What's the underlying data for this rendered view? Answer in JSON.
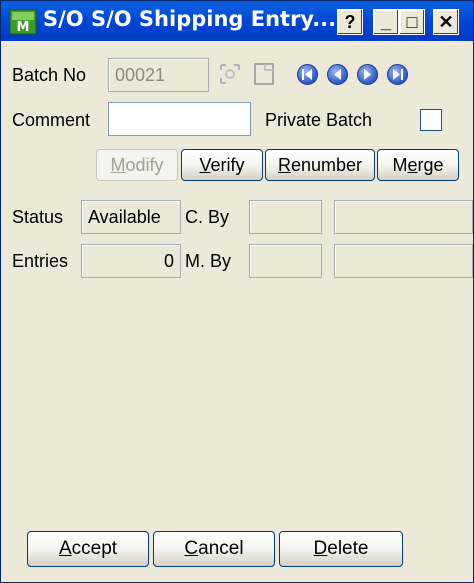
{
  "window": {
    "title": "S/O S/O Shipping Entry...",
    "help_label": "?",
    "minimize_label": "_",
    "maximize_label": "□",
    "close_label": "✕"
  },
  "batch": {
    "label": "Batch No",
    "value": "00021"
  },
  "comment": {
    "label": "Comment",
    "value": ""
  },
  "private_batch": {
    "label": "Private Batch",
    "checked": false
  },
  "buttons": {
    "modify": {
      "pre": "",
      "u": "M",
      "post": "odify"
    },
    "verify": {
      "pre": "",
      "u": "V",
      "post": "erify"
    },
    "renumber": {
      "pre": "",
      "u": "R",
      "post": "enumber"
    },
    "merge": {
      "pre": "M",
      "u": "e",
      "post": "rge"
    },
    "accept": {
      "pre": "",
      "u": "A",
      "post": "ccept"
    },
    "cancel": {
      "pre": "",
      "u": "C",
      "post": "ancel"
    },
    "delete": {
      "pre": "",
      "u": "D",
      "post": "elete"
    }
  },
  "status": {
    "label": "Status",
    "value": "Available",
    "created_by_label": "C. By",
    "created_by": "",
    "created_extra": ""
  },
  "entries": {
    "label": "Entries",
    "value": "0",
    "modified_by_label": "M. By",
    "modified_by": "",
    "modified_extra": ""
  },
  "icons": {
    "app": "sage-mas-app-icon",
    "lookup": "lookup-icon",
    "new_batch": "new-batch-icon",
    "nav": [
      "first-record-icon",
      "previous-record-icon",
      "next-record-icon",
      "last-record-icon"
    ]
  }
}
